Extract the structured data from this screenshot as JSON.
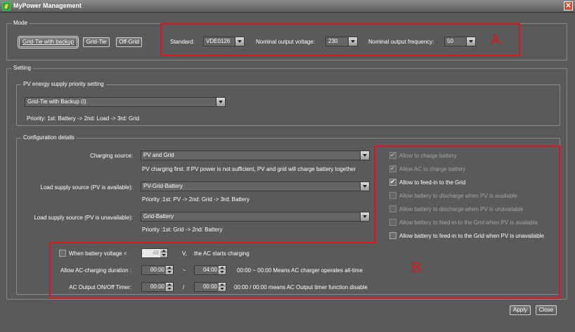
{
  "window": {
    "title": "MyPower Management",
    "close_glyph": "✕"
  },
  "mode": {
    "legend": "Mode",
    "buttons": [
      "Grid-Tie with backup",
      "Grid-Tie",
      "Off-Grid"
    ],
    "standard_label": "Standard:",
    "standard_value": "VDE0126",
    "voltage_label": "Nominal output voltage:",
    "voltage_value": "230",
    "frequency_label": "Nominal output frequency:",
    "frequency_value": "50",
    "annotation": "A"
  },
  "setting": {
    "legend": "Setting",
    "priority_legend": "PV energy supply priority setting",
    "priority_value": "Grid-Tie with Backup (I)",
    "priority_text": "Priority: 1st: Battery -> 2nd: Load -> 3rd: Grid"
  },
  "config": {
    "legend": "Configuration details",
    "charging_label": "Charging source:",
    "charging_value": "PV and Grid",
    "charging_desc": "PV charging first. If PV power is not sufficient, PV and grid will charge battery together",
    "load_pv_label": "Load supply source (PV is available):",
    "load_pv_value": "PV-Grid-Battery",
    "load_pv_desc": "Priority :1st: PV -> 2nd: Grid -> 3rd: Battery",
    "load_nopv_label": "Load supply source (PV is unavailable):",
    "load_nopv_value": "Grid-Battery",
    "load_nopv_desc": "Priority :1st: Grid -> 2nd: Battery",
    "checkboxes": [
      {
        "label": "Allow to charge battery",
        "checked": true,
        "enabled": false
      },
      {
        "label": "Allow AC to charge battery",
        "checked": true,
        "enabled": false
      },
      {
        "label": "Allow to feed-in to the Grid",
        "checked": true,
        "enabled": true
      },
      {
        "label": "Allow battery to discharge when PV is available",
        "checked": false,
        "enabled": false
      },
      {
        "label": "Allow battery to discharge when PV is unavailable",
        "checked": false,
        "enabled": false
      },
      {
        "label": "Allow battery to feed-in to the Grid when PV is available",
        "checked": false,
        "enabled": false
      },
      {
        "label": "Allow battery to feed-in to the Grid when PV is unavailable",
        "checked": false,
        "enabled": true
      }
    ],
    "battery_voltage_label": "When battery voltage <",
    "battery_voltage_value": "48",
    "battery_voltage_unit": "V,",
    "battery_voltage_suffix": "the AC starts charging",
    "ac_duration_label": "Allow AC-charging duration :",
    "ac_duration_start": "00:00",
    "ac_duration_sep": "~",
    "ac_duration_end": "04:00",
    "ac_duration_desc": "00:00 ~ 00:00 Means AC charger operates all-time",
    "ac_timer_label": "AC Output ON/Off Timer:",
    "ac_timer_on": "00:00",
    "ac_timer_sep": "/",
    "ac_timer_off": "00:00",
    "ac_timer_desc": "00:00 / 00:00 means AC Output timer function disable",
    "annotation": "B"
  },
  "footer": {
    "apply": "Apply",
    "close": "Close"
  }
}
